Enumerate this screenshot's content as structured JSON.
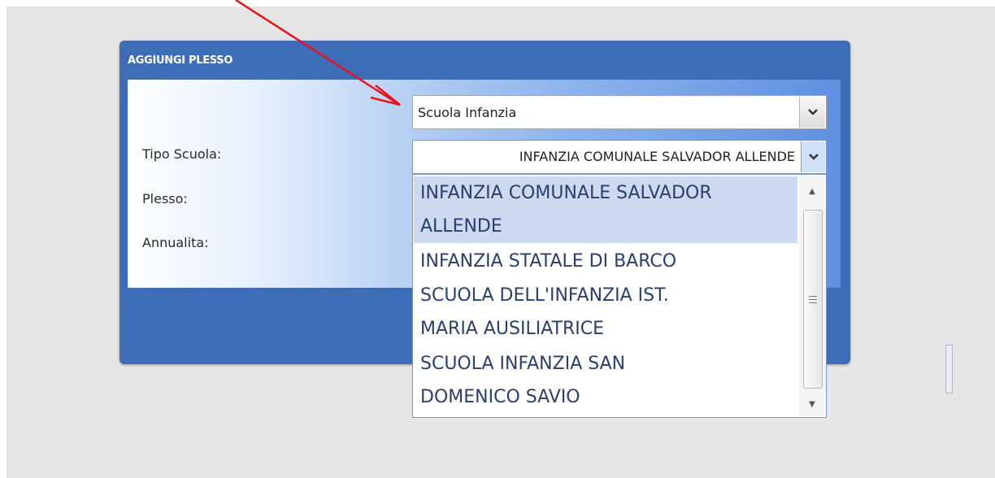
{
  "dialog": {
    "title": "AGGIUNGI PLESSO",
    "fields": {
      "tipo_scuola_label": "Tipo Scuola:",
      "plesso_label": "Plesso:",
      "annualita_label": "Annualita:"
    },
    "tipo_scuola_value": "Scuola Infanzia",
    "plesso_value": "INFANZIA COMUNALE SALVADOR ALLENDE"
  },
  "dropdown": {
    "options": [
      {
        "line1": "INFANZIA COMUNALE SALVADOR",
        "line2": "ALLENDE"
      },
      {
        "line1": "INFANZIA STATALE DI BARCO"
      },
      {
        "line1": "SCUOLA DELL'INFANZIA IST.",
        "line2": "MARIA AUSILIATRICE"
      },
      {
        "line1": "SCUOLA INFANZIA SAN",
        "line2": "DOMENICO SAVIO"
      }
    ],
    "selected_index": 0
  },
  "colors": {
    "dialog_header": "#3e6db7",
    "annotation_arrow": "#e8121b"
  },
  "icons": [
    "chevron-down-icon",
    "scroll-up-icon",
    "scroll-down-icon",
    "scroll-grip-icon",
    "annotation-arrow-icon"
  ]
}
